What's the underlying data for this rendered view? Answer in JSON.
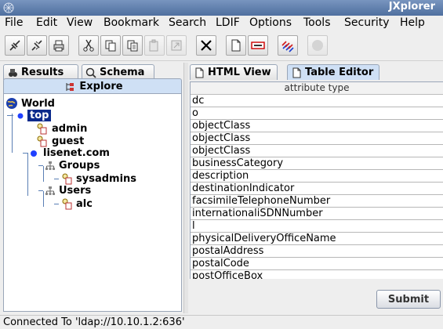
{
  "window": {
    "title": "JXplorer"
  },
  "menu": [
    {
      "label": "File"
    },
    {
      "label": "Edit"
    },
    {
      "label": "View"
    },
    {
      "label": "Bookmark"
    },
    {
      "label": "Search"
    },
    {
      "label": "LDIF"
    },
    {
      "label": "Options"
    },
    {
      "label": "Tools"
    },
    {
      "label": "Security"
    },
    {
      "label": "Help"
    }
  ],
  "left_tabs": {
    "results": "Results",
    "schema": "Schema",
    "explore": "Explore"
  },
  "tree": {
    "root": "World",
    "top": "top",
    "admin": "admin",
    "guest": "guest",
    "domain": "lisenet.com",
    "groups": "Groups",
    "sysadmins": "sysadmins",
    "users": "Users",
    "alc": "alc"
  },
  "right_tabs": {
    "html_view": "HTML View",
    "table_editor": "Table Editor"
  },
  "table": {
    "header": "attribute type",
    "rows": [
      "dc",
      "o",
      "objectClass",
      "objectClass",
      "objectClass",
      "businessCategory",
      "description",
      "destinationIndicator",
      "facsimileTelephoneNumber",
      "internationaliSDNNumber",
      "l",
      "physicalDeliveryOfficeName",
      "postalAddress",
      "postalCode",
      "postOfficeBox"
    ]
  },
  "submit_label": "Submit",
  "status": "Connected To 'ldap://10.10.1.2:636'",
  "colors": {
    "selection": "#0a2a8c",
    "title_bar": "#5b7aa9",
    "active_tab": "#cfe0f5"
  },
  "icons": [
    "connect-icon",
    "disconnect-icon",
    "print-icon",
    "cut-icon",
    "copy-icon",
    "copy-dn-icon",
    "paste-icon",
    "paste-alias-icon",
    "delete-icon",
    "new-entry-icon",
    "rename-icon",
    "refresh-icon",
    "stop-icon"
  ]
}
